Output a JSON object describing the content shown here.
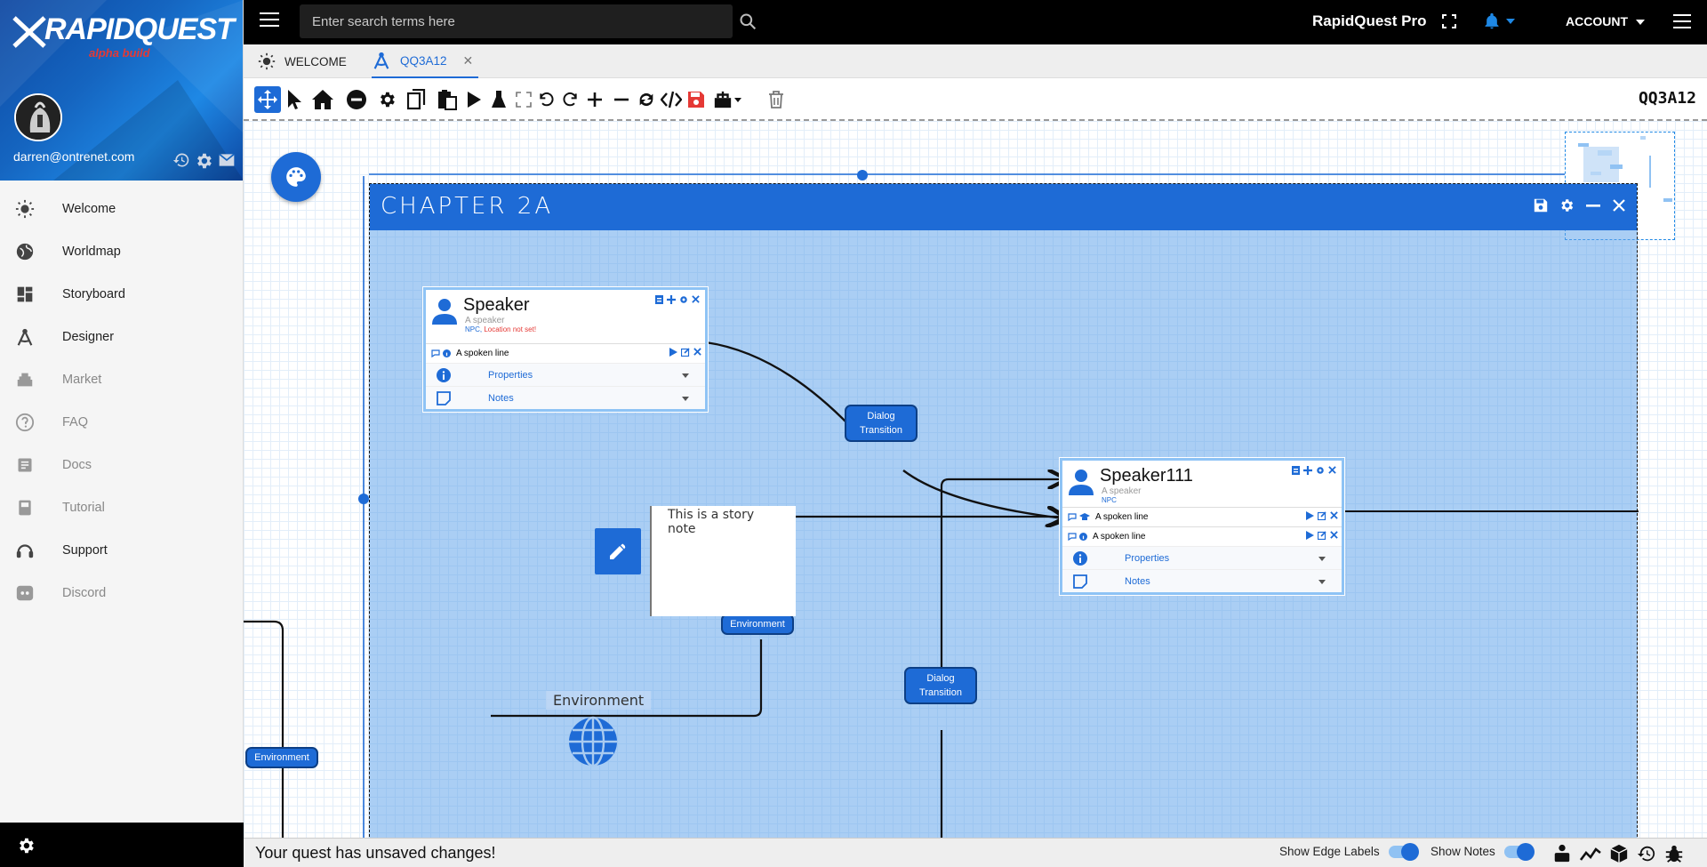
{
  "app": {
    "name": "RapidQuest Pro",
    "logo_text": "RAPIDQUEST",
    "logo_sub": "alpha build"
  },
  "topbar": {
    "search_placeholder": "Enter search terms here",
    "account_label": "ACCOUNT",
    "accent_color": "#1e6bd6"
  },
  "user": {
    "email": "darren@ontrenet.com"
  },
  "sidebar": {
    "items": [
      {
        "label": "Welcome",
        "icon": "sun-icon",
        "muted": false
      },
      {
        "label": "Worldmap",
        "icon": "globe-icon",
        "muted": false
      },
      {
        "label": "Storyboard",
        "icon": "dashboard-icon",
        "muted": false
      },
      {
        "label": "Designer",
        "icon": "compass-icon",
        "muted": false
      },
      {
        "label": "Market",
        "icon": "market-icon",
        "muted": true
      },
      {
        "label": "FAQ",
        "icon": "question-icon",
        "muted": true
      },
      {
        "label": "Docs",
        "icon": "docs-icon",
        "muted": true
      },
      {
        "label": "Tutorial",
        "icon": "book-icon",
        "muted": true
      },
      {
        "label": "Support",
        "icon": "headset-icon",
        "muted": false
      },
      {
        "label": "Discord",
        "icon": "discord-icon",
        "muted": true
      }
    ]
  },
  "tabs": [
    {
      "label": "WELCOME",
      "icon": "sun-icon"
    },
    {
      "label": "QQ3A12",
      "icon": "compass-icon",
      "active": true
    }
  ],
  "toolbar": {
    "quest_code": "QQ3A12"
  },
  "chapter": {
    "title": "CHAPTER 2A"
  },
  "nodes": {
    "speaker": {
      "title": "Speaker",
      "subtitle": "A speaker",
      "type": "NPC",
      "warning": "Location not set!",
      "lines": [
        "A spoken line"
      ],
      "properties": "Properties",
      "notes": "Notes"
    },
    "speaker111": {
      "title": "Speaker111",
      "subtitle": "A speaker",
      "type": "NPC",
      "lines": [
        "A spoken line",
        "A spoken line"
      ],
      "properties": "Properties",
      "notes": "Notes"
    }
  },
  "edges": {
    "dialog1": "Dialog Transition",
    "dialog2": "Dialog Transition",
    "env1": "Environment",
    "env2": "Environment"
  },
  "story_note": {
    "text": "This is a story note"
  },
  "environment_node": {
    "label": "Environment"
  },
  "status": {
    "message": "Your quest has unsaved changes!",
    "show_edge_labels": "Show Edge Labels",
    "show_notes": "Show Notes",
    "edge_labels_on": true,
    "notes_on": true
  }
}
